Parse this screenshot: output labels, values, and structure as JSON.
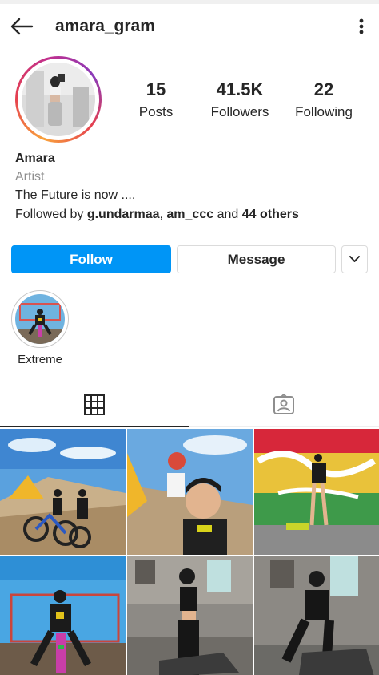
{
  "header": {
    "username": "amara_gram",
    "back_icon": "arrow-left-icon",
    "menu_icon": "more-vertical-icon"
  },
  "profile": {
    "stats": [
      {
        "value": "15",
        "label": "Posts"
      },
      {
        "value": "41.5K",
        "label": "Followers"
      },
      {
        "value": "22",
        "label": "Following"
      }
    ],
    "name": "Amara",
    "category": "Artist",
    "bio": "The Future is now ....",
    "followed_by_prefix": "Followed by ",
    "followed_by_user1": "g.undarmaa",
    "followed_by_sep": ", ",
    "followed_by_user2": "am_ccc",
    "followed_by_and": " and ",
    "followed_by_others": "44 others"
  },
  "actions": {
    "follow_label": "Follow",
    "message_label": "Message",
    "more_icon": "chevron-down-icon"
  },
  "highlights": [
    {
      "label": "Extreme"
    }
  ],
  "tabs": [
    {
      "icon": "grid-icon",
      "active": true
    },
    {
      "icon": "tagged-icon",
      "active": false
    }
  ],
  "colors": {
    "accent": "#0095f6",
    "text": "#262626",
    "muted": "#8e8e8e",
    "border": "#dbdbdb"
  }
}
